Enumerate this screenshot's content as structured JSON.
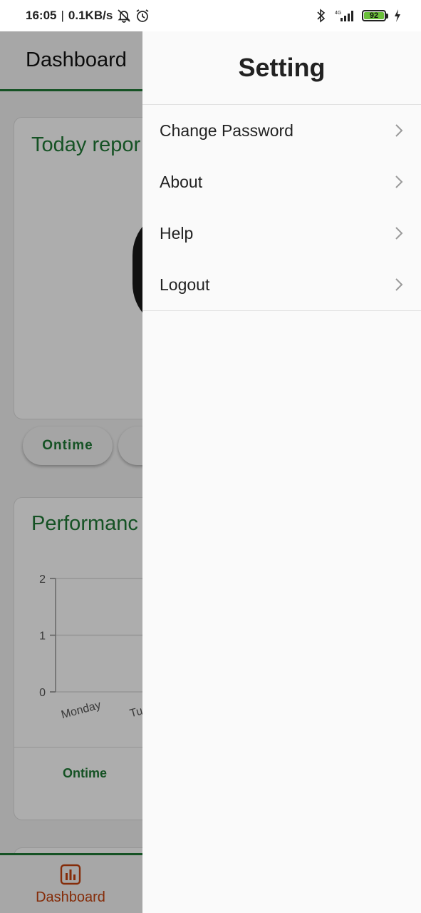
{
  "status_bar": {
    "time": "16:05",
    "separator": "|",
    "speed": "0.1KB/s",
    "network": "4G",
    "battery": "92"
  },
  "background": {
    "app_title": "Dashboard",
    "today_card_title": "Today repor",
    "pill_ontime": "Ontime",
    "performance_title": "Performanc",
    "chart_data": {
      "type": "line",
      "categories": [
        "Monday",
        "Tuesd"
      ],
      "series": [],
      "ylim": [
        0,
        2
      ],
      "yticks": [
        "2",
        "1",
        "0"
      ],
      "grid": true
    },
    "legend_ontime": "Ontime",
    "nav_dashboard": "Dashboard",
    "colors": {
      "primary": "#1f7a36",
      "nav_active": "#c4420e"
    }
  },
  "drawer": {
    "title": "Setting",
    "items": [
      {
        "label": "Change Password"
      },
      {
        "label": "About"
      },
      {
        "label": "Help"
      },
      {
        "label": "Logout"
      }
    ]
  }
}
